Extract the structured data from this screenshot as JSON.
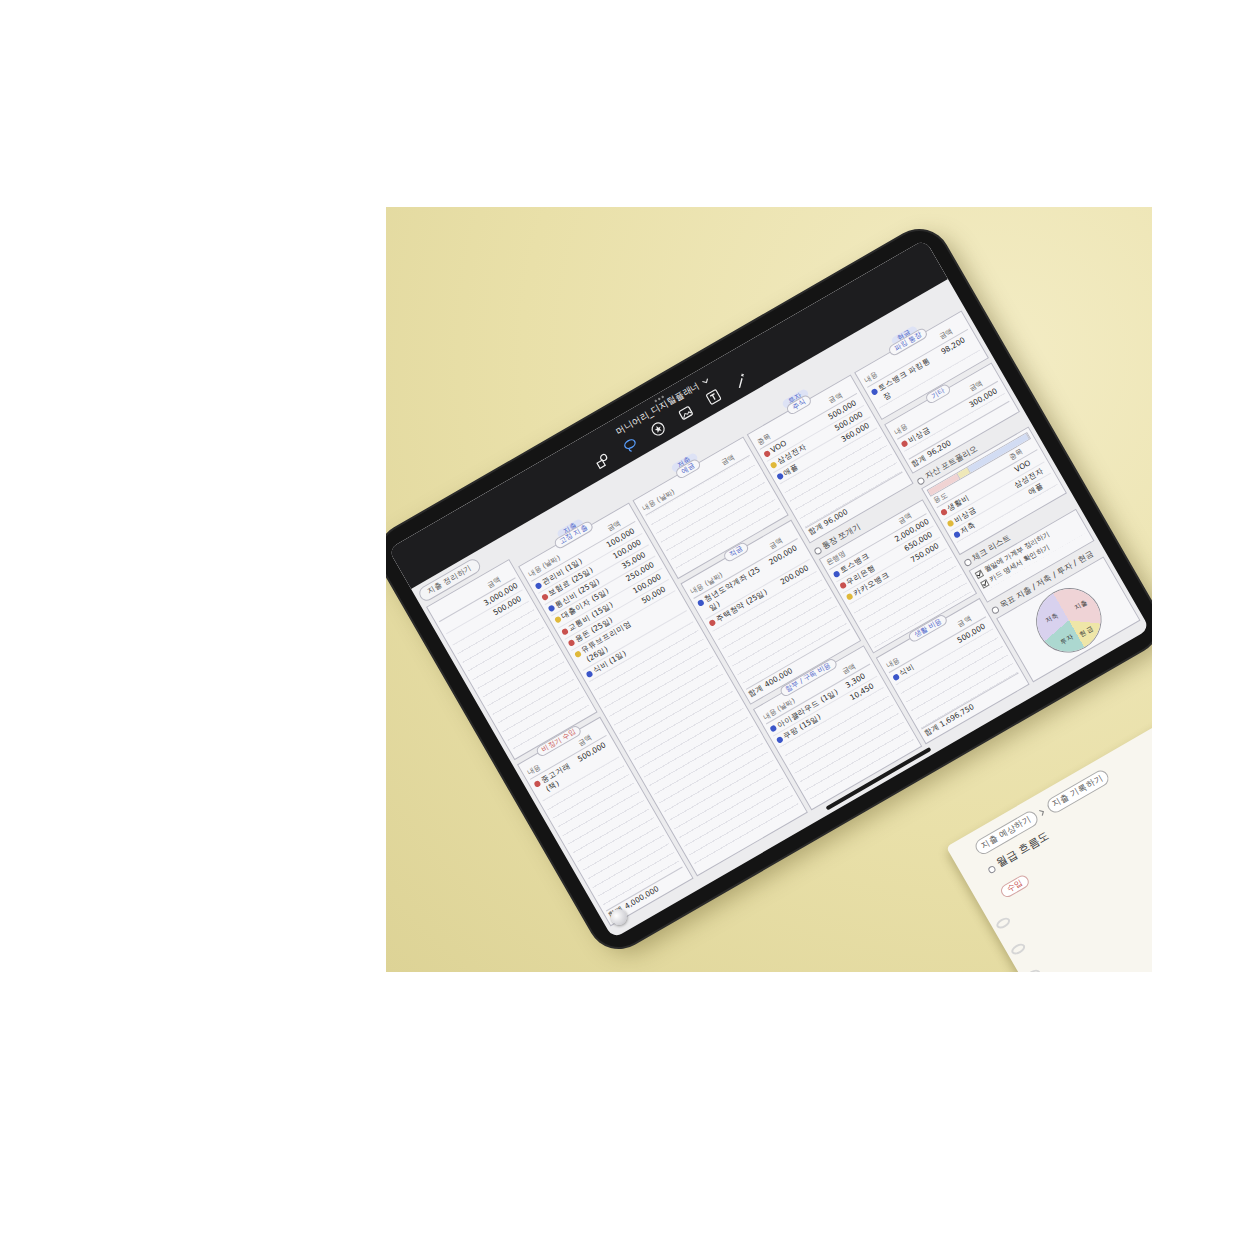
{
  "app": {
    "title": "머니어리_디지털플래너",
    "tab": "지출 정리하기"
  },
  "columns": [
    [
      {
        "kind": "pill",
        "headers": [
          "금액"
        ],
        "rows": [
          {
            "amount": "3,000,000"
          },
          {
            "amount": "500,000"
          }
        ]
      },
      {
        "kind": "pill",
        "title": "비정기 수입",
        "color": "#c9524f",
        "headers": [
          "내용",
          "금액"
        ],
        "rows": [
          {
            "label": "중고거래(책)",
            "amount": "500,000",
            "color": "#c9524f"
          }
        ],
        "total": "합계 4,000,000"
      }
    ],
    [
      {
        "kind": "pill",
        "group": "지출",
        "title": "고정 지출",
        "color": "#4a63c9",
        "headers": [
          "내용 (날짜)",
          "금액"
        ],
        "rows": [
          {
            "label": "관리비 (1일)",
            "amount": "100,000",
            "color": "#3b56c9"
          },
          {
            "label": "보험료 (25일)",
            "amount": "100,000",
            "color": "#c9524f"
          },
          {
            "label": "통신비 (25일)",
            "amount": "35,000",
            "color": "#3b56c9"
          },
          {
            "label": "대출이자 (5일)",
            "amount": "250,000",
            "color": "#e0b93a"
          },
          {
            "label": "교통비 (15일)",
            "amount": "100,000",
            "color": "#c9524f"
          },
          {
            "label": "용돈 (25일)",
            "amount": "50,000",
            "color": "#c9524f"
          },
          {
            "label": "유튜브프리미엄 (26일)",
            "color": "#e0b93a"
          },
          {
            "label": "식비 (1일)",
            "color": "#3b56c9"
          }
        ]
      }
    ],
    [
      {
        "kind": "pill",
        "group": "저축",
        "title": "예금",
        "color": "#4a63c9",
        "headers": [
          "내용 (날짜)",
          "금액"
        ],
        "rows": []
      },
      {
        "kind": "pill",
        "title": "적금",
        "color": "#4a63c9",
        "headers": [
          "내용 (날짜)",
          "금액"
        ],
        "rows": [
          {
            "label": "청년도약계좌 (25일)",
            "amount": "200,000",
            "color": "#3b56c9"
          },
          {
            "label": "주택청약 (25일)",
            "amount": "200,000",
            "color": "#c9524f"
          }
        ],
        "total": "합계 400,000"
      },
      {
        "kind": "pill",
        "title": "할부 / 구독 비용",
        "color": "#4a63c9",
        "headers": [
          "내용 (날짜)",
          "금액"
        ],
        "rows": [
          {
            "label": "아이클라우드 (1일)",
            "amount": "3,300",
            "color": "#3b56c9"
          },
          {
            "label": "쿠팡 (15일)",
            "amount": "10,450",
            "color": "#3b56c9"
          }
        ]
      }
    ],
    [
      {
        "kind": "pill",
        "group": "투자",
        "title": "주식",
        "color": "#4a63c9",
        "headers": [
          "종목",
          "금액"
        ],
        "rows": [
          {
            "label": "VOO",
            "amount": "500,000",
            "color": "#c9524f"
          },
          {
            "label": "삼성전자",
            "amount": "500,000",
            "color": "#e0b93a"
          },
          {
            "label": "애플",
            "amount": "360,000",
            "color": "#3b56c9"
          }
        ],
        "total": "합계 96,000"
      },
      {
        "kind": "heading",
        "title": "통장 쪼개기",
        "headers": [
          "은행명",
          "금액"
        ],
        "rows": [
          {
            "label": "토스뱅크",
            "amount": "2,000,000",
            "color": "#3b56c9"
          },
          {
            "label": "우리은행",
            "amount": "650,000",
            "color": "#c9524f"
          },
          {
            "label": "카카오뱅크",
            "amount": "750,000",
            "color": "#e0b93a"
          }
        ]
      },
      {
        "kind": "pill",
        "title": "생활 비용",
        "color": "#4a63c9",
        "headers": [
          "내용",
          "금액"
        ],
        "rows": [
          {
            "label": "식비",
            "amount": "500,000",
            "color": "#3b56c9"
          }
        ],
        "total": "합계 1,696,750"
      }
    ],
    [
      {
        "kind": "pill",
        "group": "현금",
        "title": "파킹 통장",
        "color": "#4a63c9",
        "headers": [
          "내용",
          "금액"
        ],
        "rows": [
          {
            "label": "토스뱅크 파킹통장",
            "amount": "98,200",
            "color": "#3b56c9"
          }
        ]
      },
      {
        "kind": "pill",
        "title": "기타",
        "color": "#4a63c9",
        "headers": [
          "내용",
          "금액"
        ],
        "rows": [
          {
            "label": "비상금",
            "amount": "300,000",
            "color": "#c9524f"
          }
        ],
        "total": "합계 96,200"
      },
      {
        "kind": "portfolio",
        "title": "자산 포트폴리오",
        "segments": [
          {
            "level": 0.3,
            "color": "#f0d3d3"
          },
          {
            "level": 0.1,
            "color": "#efe8b8"
          },
          {
            "level": 0.6,
            "color": "#d2dcf3"
          }
        ],
        "headers": [
          "용도",
          "종목"
        ],
        "rows": [
          {
            "label": "생활비",
            "amount": "VOO",
            "color": "#c9524f"
          },
          {
            "label": "비상금",
            "amount": "삼성전자",
            "color": "#e0b93a"
          },
          {
            "label": "저축",
            "amount": "애플",
            "color": "#3b56c9"
          }
        ]
      },
      {
        "kind": "checklist",
        "title": "체크 리스트",
        "items": [
          {
            "text": "월말에 가계부 정리하기",
            "checked": true
          },
          {
            "text": "카드 명세서 확인하기",
            "checked": true
          }
        ]
      },
      {
        "kind": "chart",
        "title": "목표 지출 / 저축 / 투자 / 현금",
        "slices": [
          {
            "label": "지출",
            "value": 35,
            "color": "#efd3d6"
          },
          {
            "label": "현금",
            "value": 15,
            "color": "#efe6a8"
          },
          {
            "label": "투자",
            "value": 22,
            "color": "#acd8d0"
          },
          {
            "label": "저축",
            "value": 28,
            "color": "#d8d1ee"
          }
        ]
      }
    ]
  ],
  "notebook": {
    "tabs": [
      "지출 예상하기",
      "지출 기록하기"
    ],
    "title": "월급 흐름도",
    "section": "수입"
  }
}
